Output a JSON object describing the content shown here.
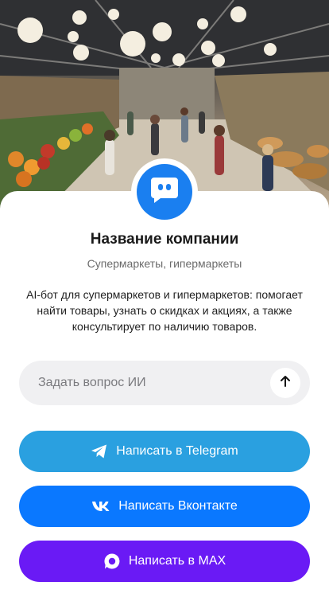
{
  "hero": {
    "image": "supermarket-interior-photo"
  },
  "company": {
    "avatar_icon": "chat-bot-icon",
    "name": "Название компании",
    "category": "Супермаркеты, гипермаркеты",
    "description": "AI-бот для супермаркетов и гипермаркетов: помогает найти товары, узнать о скидках и акциях, а также консультирует по наличию товаров."
  },
  "ask": {
    "placeholder": "Задать вопрос ИИ",
    "send_icon": "arrow-up-icon"
  },
  "buttons": {
    "telegram": {
      "label": "Написать в Telegram",
      "icon": "telegram-icon",
      "color": "#2aa0e0"
    },
    "vk": {
      "label": "Написать Вконтакте",
      "icon": "vk-icon",
      "color": "#0a78ff"
    },
    "max": {
      "label": "Написать в MAX",
      "icon": "max-icon",
      "color": "#6a1af5"
    }
  },
  "colors": {
    "accent": "#1a7ff0"
  }
}
